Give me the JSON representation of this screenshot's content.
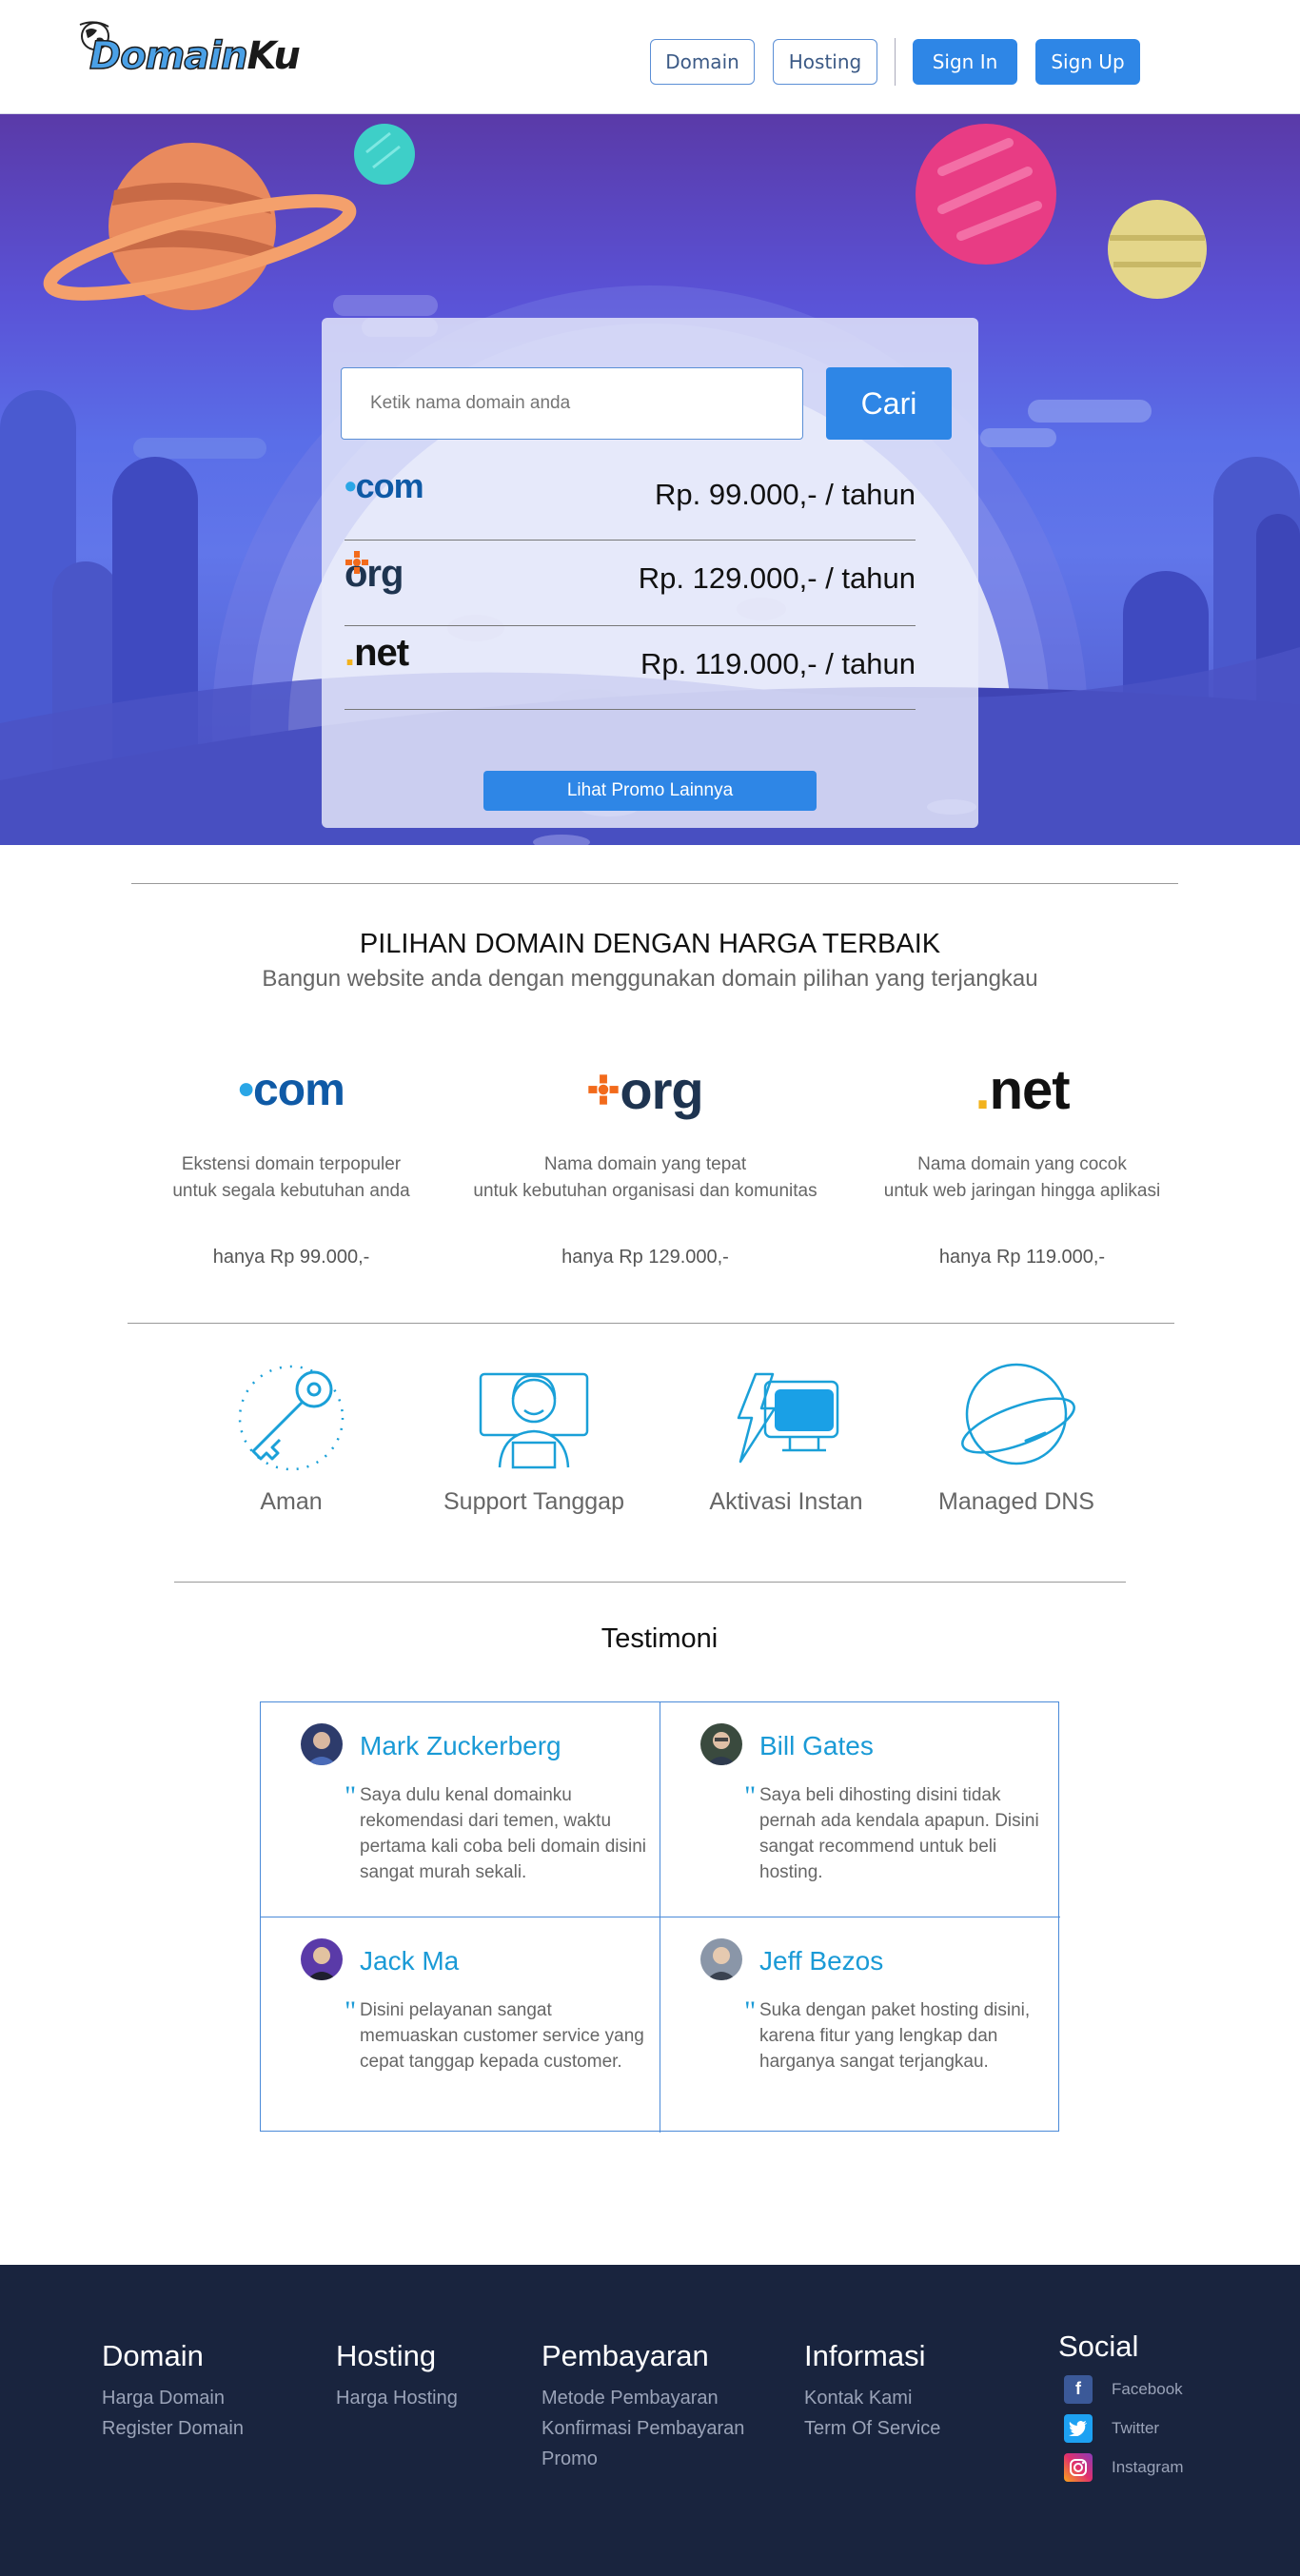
{
  "brand": {
    "name_a": "Domain",
    "name_b": "Ku"
  },
  "nav": {
    "domain": "Domain",
    "hosting": "Hosting",
    "sign_in": "Sign In",
    "sign_up": "Sign Up"
  },
  "search": {
    "placeholder": "Ketik nama domain anda",
    "button": "Cari"
  },
  "tlds": [
    {
      "name": "com",
      "price": "Rp. 99.000,- / tahun"
    },
    {
      "name": "org",
      "price": "Rp. 129.000,- / tahun"
    },
    {
      "name": "net",
      "price": "Rp. 119.000,- / tahun"
    }
  ],
  "promo_button": "Lihat Promo Lainnya",
  "choice": {
    "title": "PILIHAN DOMAIN DENGAN HARGA TERBAIK",
    "subtitle": "Bangun website anda dengan menggunakan domain pilihan yang terjangkau",
    "items": [
      {
        "tld": "com",
        "desc": "Ekstensi domain terpopuler\nuntuk segala kebutuhan anda",
        "price": "hanya Rp 99.000,-"
      },
      {
        "tld": "org",
        "desc": "Nama domain yang tepat\nuntuk kebutuhan organisasi dan komunitas",
        "price": "hanya Rp 129.000,-"
      },
      {
        "tld": "net",
        "desc": "Nama domain yang cocok\nuntuk web jaringan hingga aplikasi",
        "price": "hanya Rp 119.000,-"
      }
    ]
  },
  "features": [
    {
      "label": "Aman",
      "icon": "key-icon"
    },
    {
      "label": "Support Tanggap",
      "icon": "support-agent-icon"
    },
    {
      "label": "Aktivasi Instan",
      "icon": "instant-activation-icon"
    },
    {
      "label": "Managed DNS",
      "icon": "planet-dns-icon"
    }
  ],
  "testimonials": {
    "title": "Testimoni",
    "items": [
      {
        "name": "Mark Zuckerberg",
        "quote": "Saya dulu kenal domainku rekomendasi dari temen, waktu pertama kali coba beli domain disini sangat murah sekali."
      },
      {
        "name": "Bill Gates",
        "quote": "Saya beli dihosting disini tidak pernah ada kendala apapun. Disini sangat recommend untuk beli hosting."
      },
      {
        "name": "Jack Ma",
        "quote": "Disini pelayanan sangat memuaskan customer service yang cepat tanggap kepada customer."
      },
      {
        "name": "Jeff Bezos",
        "quote": "Suka dengan paket hosting disini, karena fitur yang lengkap dan harganya sangat terjangkau."
      }
    ]
  },
  "footer": {
    "domain": {
      "title": "Domain",
      "links": [
        "Harga Domain",
        "Register Domain"
      ]
    },
    "hosting": {
      "title": "Hosting",
      "links": [
        "Harga Hosting"
      ]
    },
    "payment": {
      "title": "Pembayaran",
      "links": [
        "Metode Pembayaran",
        "Konfirmasi Pembayaran",
        "Promo"
      ]
    },
    "info": {
      "title": "Informasi",
      "links": [
        "Kontak Kami",
        "Term Of Service"
      ]
    },
    "social": {
      "title": "Social",
      "links": [
        "Facebook",
        "Twitter",
        "Instagram"
      ]
    }
  },
  "colors": {
    "primary": "#2e86e6",
    "accent": "#1a9ad6",
    "footer_bg": "#19243e"
  }
}
